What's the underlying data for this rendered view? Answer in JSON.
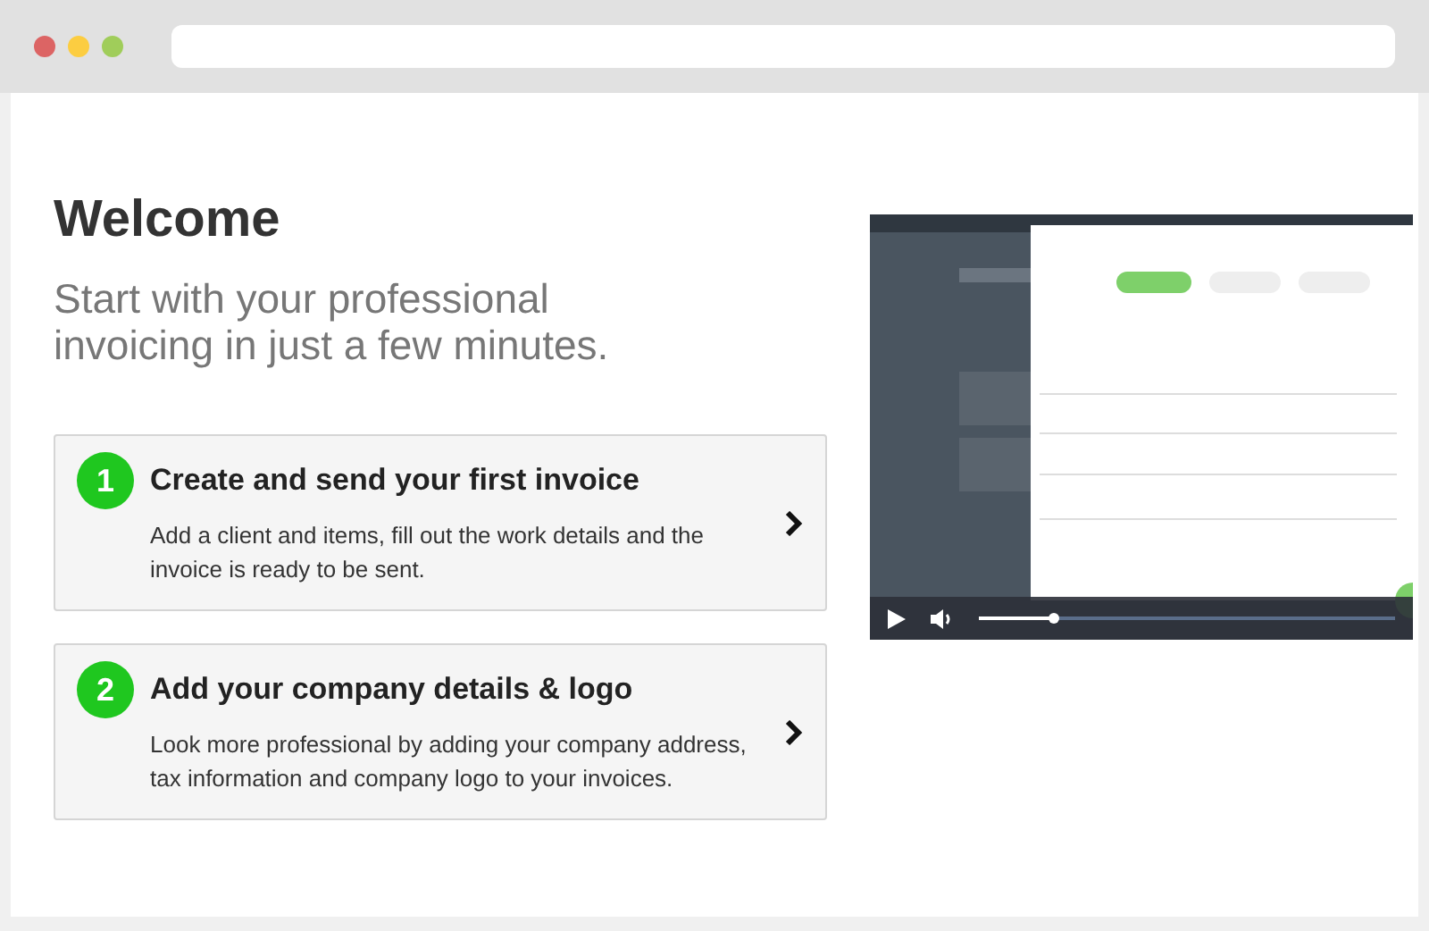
{
  "heading": "Welcome",
  "subheading": "Start with your professional invoicing in just a few minutes.",
  "steps": [
    {
      "number": "1",
      "title": "Create and send your first invoice",
      "description": "Add a client and items, fill out the work details and the invoice is ready to be sent."
    },
    {
      "number": "2",
      "title": "Add your company details & logo",
      "description": "Look more professional by adding your company address, tax information and company logo to your invoices."
    }
  ],
  "video": {
    "progress": {
      "level": 0.18
    }
  }
}
